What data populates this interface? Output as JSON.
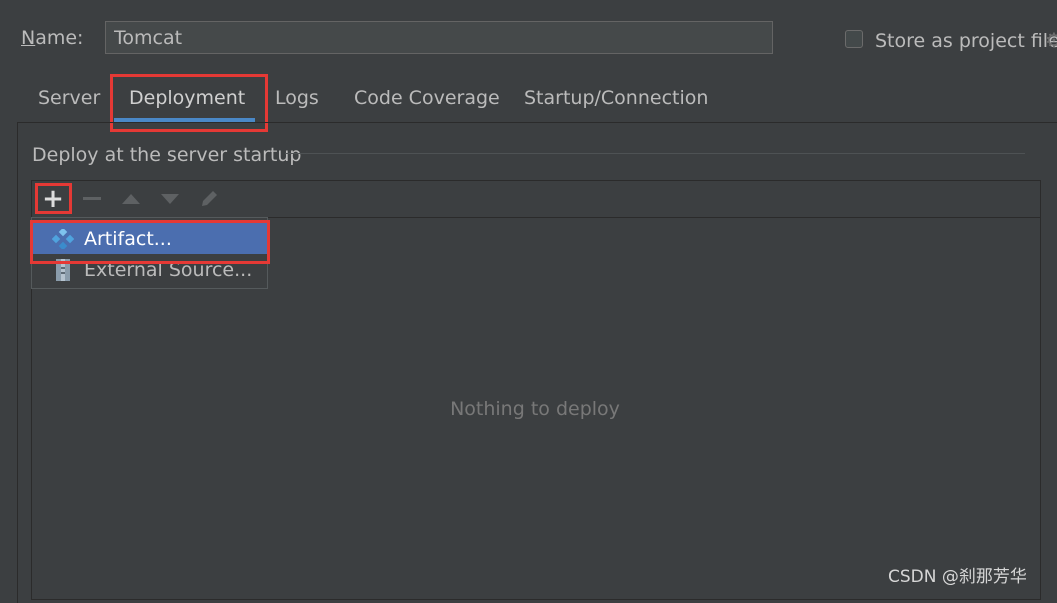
{
  "form": {
    "name_label": "Name:",
    "name_label_mnemonic": "N",
    "name_label_rest": "ame:",
    "name_value": "Tomcat",
    "store_label": "Store as project file",
    "store_checked": false
  },
  "tabs": [
    {
      "label": "Server",
      "selected": false
    },
    {
      "label": "Deployment",
      "selected": true
    },
    {
      "label": "Logs",
      "selected": false
    },
    {
      "label": "Code Coverage",
      "selected": false
    },
    {
      "label": "Startup/Connection",
      "selected": false
    }
  ],
  "deploy": {
    "section_title": "Deploy at the server startup",
    "empty_text": "Nothing to deploy",
    "toolbar_icons": [
      "add-icon",
      "remove-icon",
      "move-up-icon",
      "move-down-icon",
      "edit-icon"
    ]
  },
  "popup_menu": {
    "items": [
      {
        "label": "Artifact...",
        "icon": "artifact-icon",
        "selected": true
      },
      {
        "label": "External Source...",
        "icon": "external-source-icon",
        "selected": false
      }
    ]
  },
  "watermark": "CSDN @刹那芳华⁠",
  "colors": {
    "background": "#3c3f41",
    "accent": "#4a88c7",
    "selection": "#4b6eaf",
    "highlight_box": "#e53935"
  }
}
